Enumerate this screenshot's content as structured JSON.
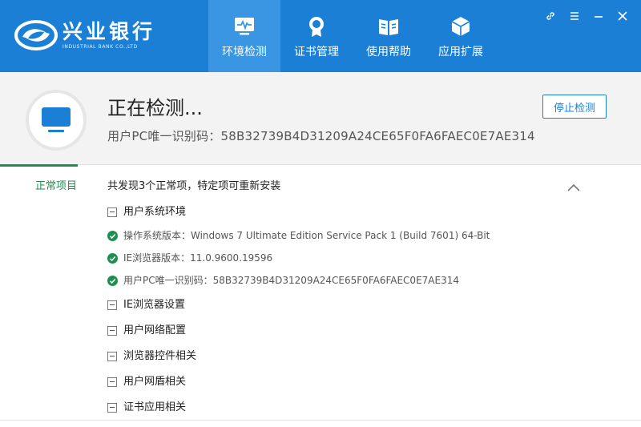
{
  "brand": {
    "name_cn": "兴业银行",
    "name_en": "INDUSTRIAL BANK CO.,LTD",
    "logo_icon": "industrial-bank-logo"
  },
  "nav": {
    "tabs": [
      {
        "label": "环境检测",
        "icon": "monitor-pulse-icon",
        "active": true
      },
      {
        "label": "证书管理",
        "icon": "certificate-badge-icon",
        "active": false
      },
      {
        "label": "使用帮助",
        "icon": "open-book-icon",
        "active": false
      },
      {
        "label": "应用扩展",
        "icon": "cube-icon",
        "active": false
      }
    ]
  },
  "window_controls": [
    "link-icon",
    "menu-icon",
    "minimize-icon",
    "close-icon"
  ],
  "status": {
    "title": "正在检测...",
    "pc_id_line": "用户PC唯一识别码：58B32739B4D31209A24CE65F0FA6FAEC0E7AE314",
    "stop_button": "停止检测"
  },
  "results": {
    "side_label": "正常项目",
    "summary": "共发现3个正常项，特定项可重新安装",
    "groups": [
      {
        "label": "用户系统环境",
        "items": [
          "操作系统版本：Windows 7 Ultimate Edition Service Pack 1 (Build 7601) 64-Bit",
          "IE浏览器版本：11.0.9600.19596",
          "用户PC唯一识别码：58B32739B4D31209A24CE65F0FA6FAEC0E7AE314"
        ]
      },
      {
        "label": "IE浏览器设置",
        "items": []
      },
      {
        "label": "用户网络配置",
        "items": []
      },
      {
        "label": "浏览器控件相关",
        "items": []
      },
      {
        "label": "用户网盾相关",
        "items": []
      },
      {
        "label": "证书应用相关",
        "items": []
      }
    ]
  },
  "colors": {
    "brand_blue": "#1a7fd5",
    "active_tab": "#3a95e2",
    "ok_green": "#1e8f4e",
    "panel_gray": "#f3f3f3"
  }
}
